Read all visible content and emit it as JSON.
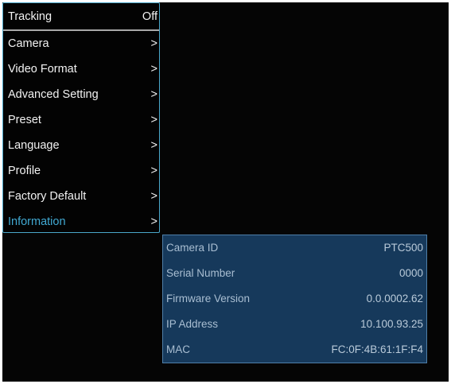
{
  "menu": {
    "header": {
      "label": "Tracking",
      "value": "Off"
    },
    "items": [
      {
        "label": "Camera",
        "arrow": ">"
      },
      {
        "label": "Video Format",
        "arrow": ">"
      },
      {
        "label": "Advanced Setting",
        "arrow": ">"
      },
      {
        "label": "Preset",
        "arrow": ">"
      },
      {
        "label": "Language",
        "arrow": ">"
      },
      {
        "label": "Profile",
        "arrow": ">"
      },
      {
        "label": "Factory Default",
        "arrow": ">"
      },
      {
        "label": "Information",
        "arrow": ">"
      }
    ],
    "selected_color": "#41a9d2"
  },
  "information": {
    "rows": [
      {
        "key": "Camera ID",
        "value": "PTC500"
      },
      {
        "key": "Serial Number",
        "value": "0000"
      },
      {
        "key": "Firmware Version",
        "value": "0.0.0002.62"
      },
      {
        "key": "IP Address",
        "value": "10.100.93.25"
      },
      {
        "key": "MAC",
        "value": "FC:0F:4B:61:1F:F4"
      }
    ],
    "panel_color": "#16395b"
  }
}
